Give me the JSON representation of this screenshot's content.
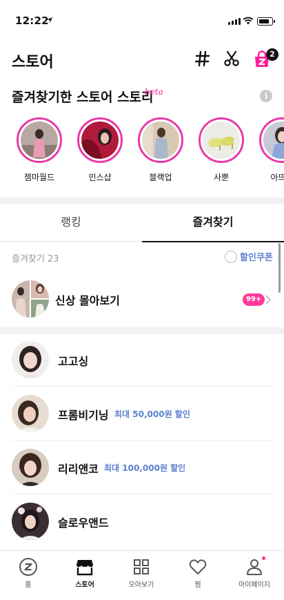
{
  "status_bar": {
    "time": "12:22",
    "battery_level": 0.85
  },
  "header": {
    "title": "스토어",
    "icons": [
      "hashtag-icon",
      "scissors-icon",
      "cart-icon"
    ],
    "cart_badge": "2"
  },
  "stories": {
    "title": "즐겨찾기한 스토어 스토리",
    "beta_label": "beta",
    "info_icon": "i",
    "items": [
      {
        "label": "젬마월드"
      },
      {
        "label": "민스샵"
      },
      {
        "label": "블랙업"
      },
      {
        "label": "사뿐"
      },
      {
        "label": "아뜨랑"
      }
    ],
    "ring_color": "#e83aa8"
  },
  "tabs": [
    {
      "label": "랭킹"
    },
    {
      "label": "즐겨찾기",
      "active": true
    }
  ],
  "favorites": {
    "count_label": "즐겨찾기 23",
    "coupon_label": "할인쿠폰",
    "new_arrivals": {
      "label": "신상 몰아보기",
      "badge": "99+"
    },
    "stores": [
      {
        "name": "고고싱",
        "promo": ""
      },
      {
        "name": "프롬비기닝",
        "promo": "최대 50,000원 할인"
      },
      {
        "name": "리리앤코",
        "promo": "최대 100,000원 할인"
      },
      {
        "name": "슬로우앤드",
        "promo": ""
      }
    ]
  },
  "bottom_nav": [
    {
      "label": "홈",
      "icon": "zigzag-home-icon"
    },
    {
      "label": "스토어",
      "icon": "store-icon",
      "active": true
    },
    {
      "label": "모아보기",
      "icon": "grid-icon"
    },
    {
      "label": "찜",
      "icon": "heart-icon"
    },
    {
      "label": "마이페이지",
      "icon": "person-icon"
    }
  ],
  "colors": {
    "accent": "#ff1f9a",
    "promo": "#5d7fcf",
    "badge": "#ff3b9a"
  }
}
